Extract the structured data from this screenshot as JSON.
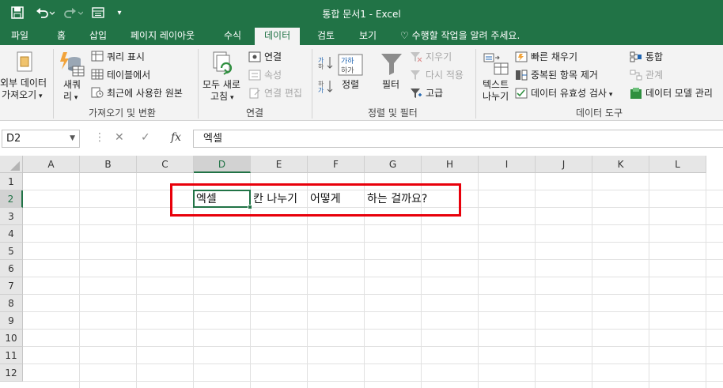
{
  "title_bar": {
    "title": "통합 문서1 - Excel"
  },
  "tabs": [
    "파일",
    "홈",
    "삽입",
    "페이지 레이아웃",
    "수식",
    "데이터",
    "검토",
    "보기"
  ],
  "active_tab": "데이터",
  "tell_me": "수행할 작업을 알려 주세요.",
  "ribbon": {
    "get_external": {
      "line1": "외부 데이터",
      "line2": "가져오기"
    },
    "new_query": {
      "line1": "새쿼",
      "line2": "리"
    },
    "show_queries": "쿼리 표시",
    "from_table": "테이블에서",
    "recent_sources": "최근에 사용한 원본",
    "group_get_transform": "가져오기 및 변환",
    "refresh_all": {
      "line1": "모두 새로",
      "line2": "고침"
    },
    "connections": "연결",
    "properties": "속성",
    "edit_links": "연결 편집",
    "group_connections": "연결",
    "sort": "정렬",
    "filter": "필터",
    "clear": "지우기",
    "reapply": "다시 적용",
    "advanced": "고급",
    "group_sort_filter": "정렬 및 필터",
    "text_to_columns": {
      "line1": "텍스트",
      "line2": "나누기"
    },
    "flash_fill": "빠른 채우기",
    "remove_duplicates": "중복된 항목 제거",
    "data_validation": "데이터 유효성 검사",
    "consolidate": "통합",
    "relationships": "관계",
    "manage_data_model": "데이터 모델 관리",
    "group_data_tools": "데이터 도구"
  },
  "formula_bar": {
    "name_box": "D2",
    "fx": "fx",
    "formula": "엑셀"
  },
  "columns": [
    "A",
    "B",
    "C",
    "D",
    "E",
    "F",
    "G",
    "H",
    "I",
    "J",
    "K",
    "L"
  ],
  "rows": [
    "1",
    "2",
    "3",
    "4",
    "5",
    "6",
    "7",
    "8",
    "9",
    "10",
    "11",
    "12"
  ],
  "cells": {
    "D2": "엑셀",
    "E2": "칸 나누기",
    "F2": "어떻게",
    "G2": "하는 걸까요?"
  },
  "active_cell": "D2",
  "accent_color": "#217346",
  "highlight_color": "#e8000b"
}
